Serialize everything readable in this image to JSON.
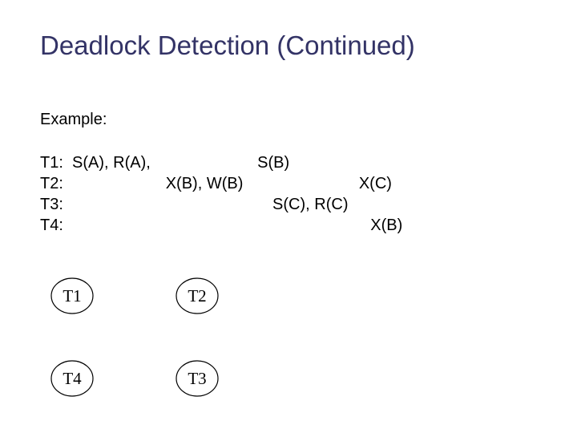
{
  "title": "Deadlock Detection (Continued)",
  "example_label": "Example:",
  "tx": {
    "t1": "T1:  S(A), R(A),                        S(B)",
    "t2": "T2:                       X(B), W(B)                          X(C)",
    "t3": "T3:                                               S(C), R(C)",
    "t4": "T4:                                                                     X(B)"
  },
  "nodes": {
    "t1": "T1",
    "t2": "T2",
    "t3": "T3",
    "t4": "T4"
  }
}
